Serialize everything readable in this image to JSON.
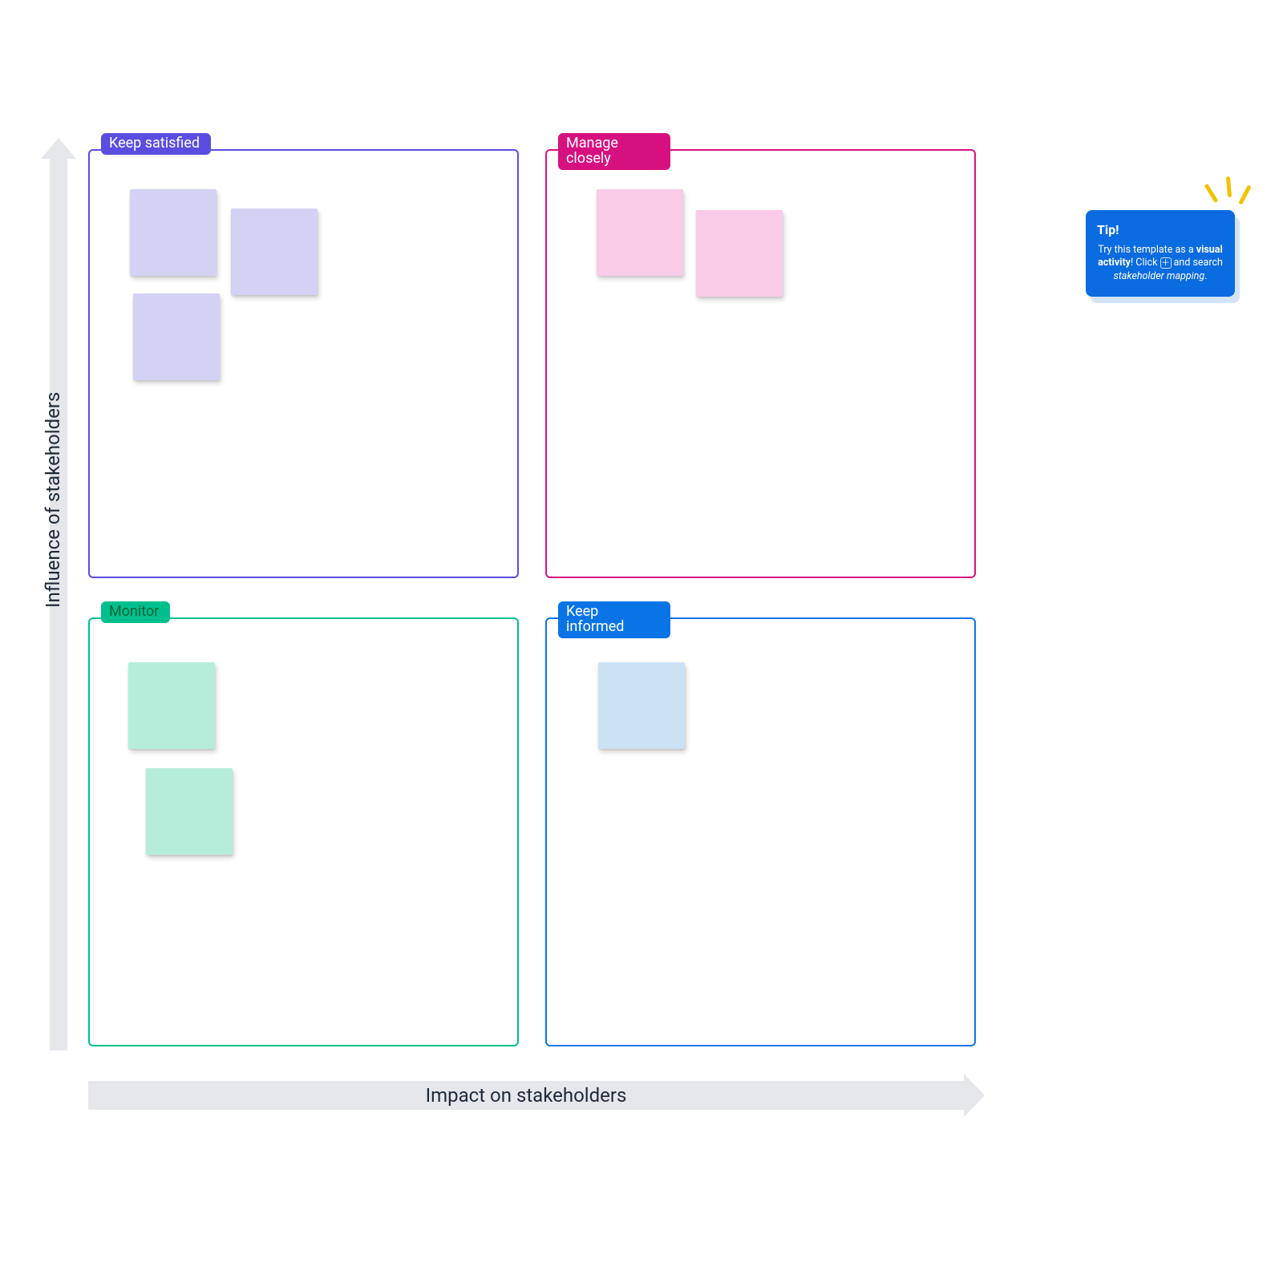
{
  "axes": {
    "x_label": "Impact on stakeholders",
    "y_label": "Influence of stakeholders"
  },
  "quadrants": {
    "top_left": {
      "label": "Keep satisfied",
      "color": "#5a4de0"
    },
    "top_right": {
      "label": "Manage closely",
      "color": "#d6117f"
    },
    "bottom_left": {
      "label": "Monitor",
      "color": "#00bf8f"
    },
    "bottom_right": {
      "label": "Keep informed",
      "color": "#0a74e6"
    }
  },
  "stickies": {
    "top_left": [
      {
        "color": "purple"
      },
      {
        "color": "purple"
      },
      {
        "color": "purple"
      }
    ],
    "top_right": [
      {
        "color": "pink"
      },
      {
        "color": "pink"
      }
    ],
    "bottom_left": [
      {
        "color": "mint"
      },
      {
        "color": "mint"
      }
    ],
    "bottom_right": [
      {
        "color": "blue"
      }
    ]
  },
  "tip": {
    "title": "Tip!",
    "line1": "Try this template as a",
    "bold": "visual activity",
    "line2": "! Click",
    "icon_label": "+",
    "line3": "and search",
    "italic": "stakeholder mapping",
    "tail": "."
  }
}
